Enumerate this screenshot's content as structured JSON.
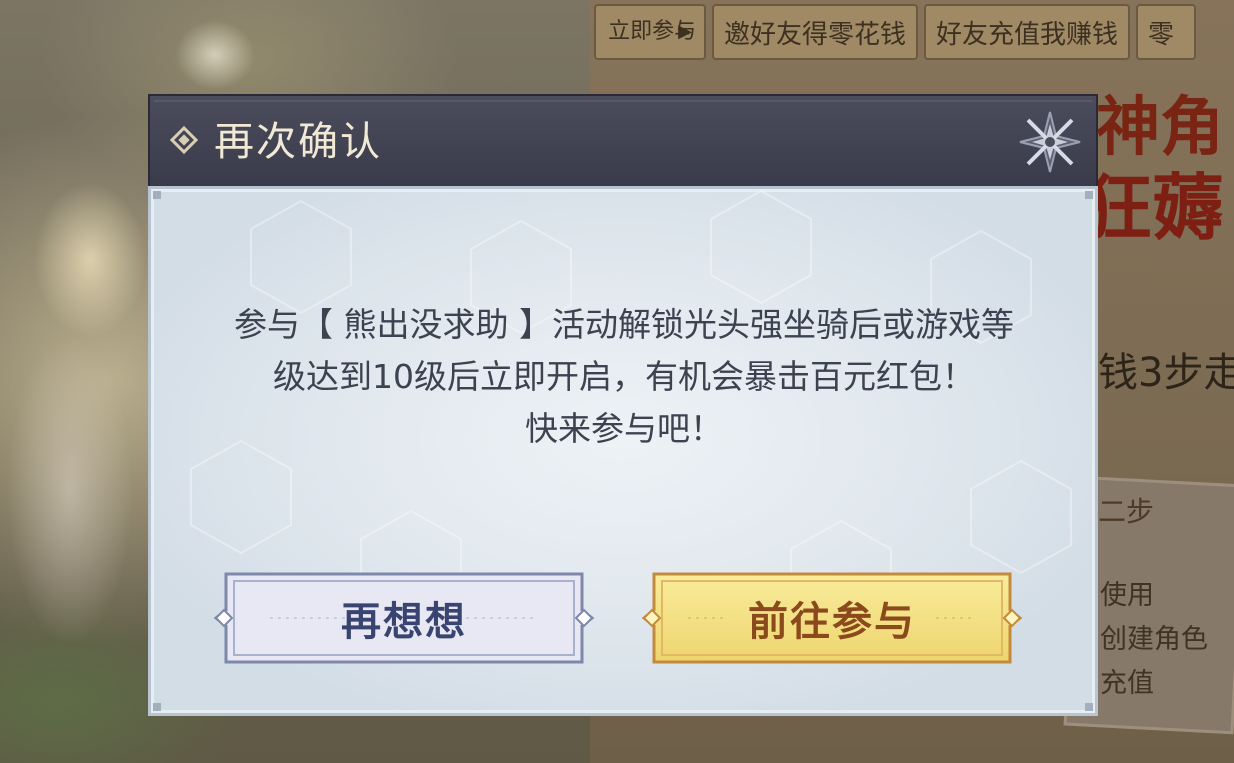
{
  "background": {
    "tabs": [
      {
        "label": "立即参与"
      },
      {
        "label": "邀好友得零花钱"
      },
      {
        "label": "好友充值我赚钱"
      },
      {
        "label": "零"
      }
    ],
    "banner_line1": "神角",
    "banner_line2": "狂薅",
    "steps_text": "钱3步走",
    "card_title": "二步",
    "card_lines": [
      "使用",
      "创建角色",
      "充值"
    ]
  },
  "dialog": {
    "title": "再次确认",
    "message_line1": "参与【 熊出没求助 】活动解锁光头强坐骑后或游戏等",
    "message_line2": "级达到10级后立即开启，有机会暴击百元红包！",
    "message_line3": "快来参与吧！",
    "cancel_label": "再想想",
    "confirm_label": "前往参与"
  },
  "colors": {
    "header_bg": "#3f404f",
    "body_bg": "#e3eaf0",
    "cancel_button": "#e7e7f3",
    "confirm_button": "#f3e08a",
    "title_text": "#f1e9d6",
    "message_text": "#3d4250"
  },
  "icons": {
    "title": "diamond-icon",
    "close": "close-star-icon"
  }
}
